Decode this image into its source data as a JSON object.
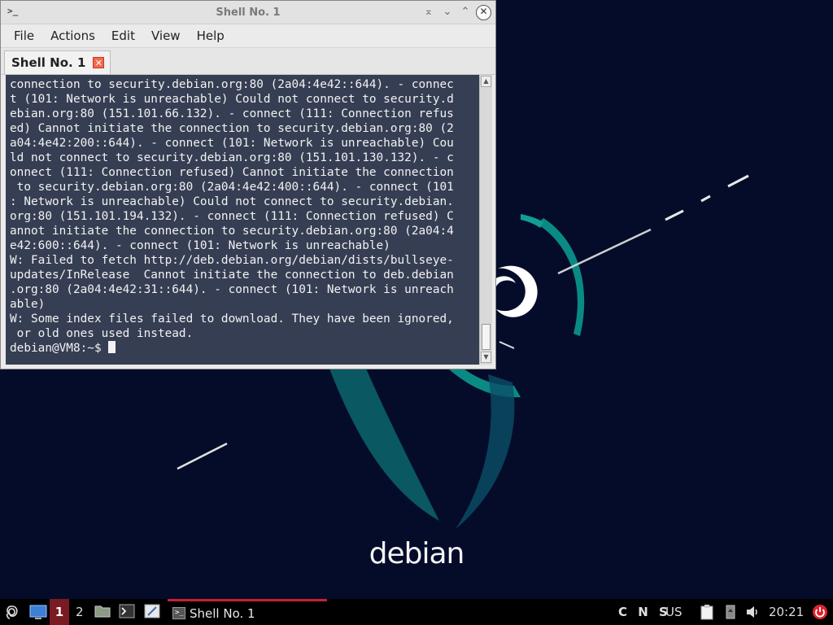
{
  "window": {
    "title": "Shell No. 1",
    "controls": [
      "⌅",
      "⌄",
      "⌃",
      "✕"
    ]
  },
  "menubar": {
    "items": [
      "File",
      "Actions",
      "Edit",
      "View",
      "Help"
    ]
  },
  "tab": {
    "label": "Shell No. 1",
    "close_glyph": "✕"
  },
  "terminal": {
    "lines": [
      "connection to security.debian.org:80 (2a04:4e42::644). - connec",
      "t (101: Network is unreachable) Could not connect to security.d",
      "ebian.org:80 (151.101.66.132). - connect (111: Connection refus",
      "ed) Cannot initiate the connection to security.debian.org:80 (2",
      "a04:4e42:200::644). - connect (101: Network is unreachable) Cou",
      "ld not connect to security.debian.org:80 (151.101.130.132). - c",
      "onnect (111: Connection refused) Cannot initiate the connection",
      " to security.debian.org:80 (2a04:4e42:400::644). - connect (101",
      ": Network is unreachable) Could not connect to security.debian.",
      "org:80 (151.101.194.132). - connect (111: Connection refused) C",
      "annot initiate the connection to security.debian.org:80 (2a04:4",
      "e42:600::644). - connect (101: Network is unreachable)",
      "W: Failed to fetch http://deb.debian.org/debian/dists/bullseye-",
      "updates/InRelease  Cannot initiate the connection to deb.debian",
      ".org:80 (2a04:4e42:31::644). - connect (101: Network is unreach",
      "able)",
      "W: Some index files failed to download. They have been ignored,",
      " or old ones used instead."
    ],
    "prompt": "debian@VM8:~$ "
  },
  "wallpaper": {
    "logo_text": "debian"
  },
  "taskbar": {
    "desktop_1": "1",
    "desktop_2": "2",
    "task_label": "Shell No. 1",
    "task_icon_glyph": ">_",
    "indicators": "C N S",
    "keyboard_layout": "US",
    "clock": "20:21"
  },
  "colors": {
    "wallpaper_bg": "#050c2a",
    "swirl_teal": "#0a8a84",
    "debian_red": "#d70a53",
    "active_desktop": "#7a1a22",
    "task_indicator": "#c8212f",
    "power_red": "#e0232e"
  },
  "icons": {
    "start_menu": "debian-swirl-icon",
    "show_desktop": "desktop-icon",
    "file_manager": "folder-icon",
    "terminal": "terminal-icon",
    "text_editor": "text-editor-icon",
    "clipboard": "clipboard-icon",
    "usb": "usb-icon",
    "volume": "speaker-icon",
    "power": "power-icon"
  }
}
